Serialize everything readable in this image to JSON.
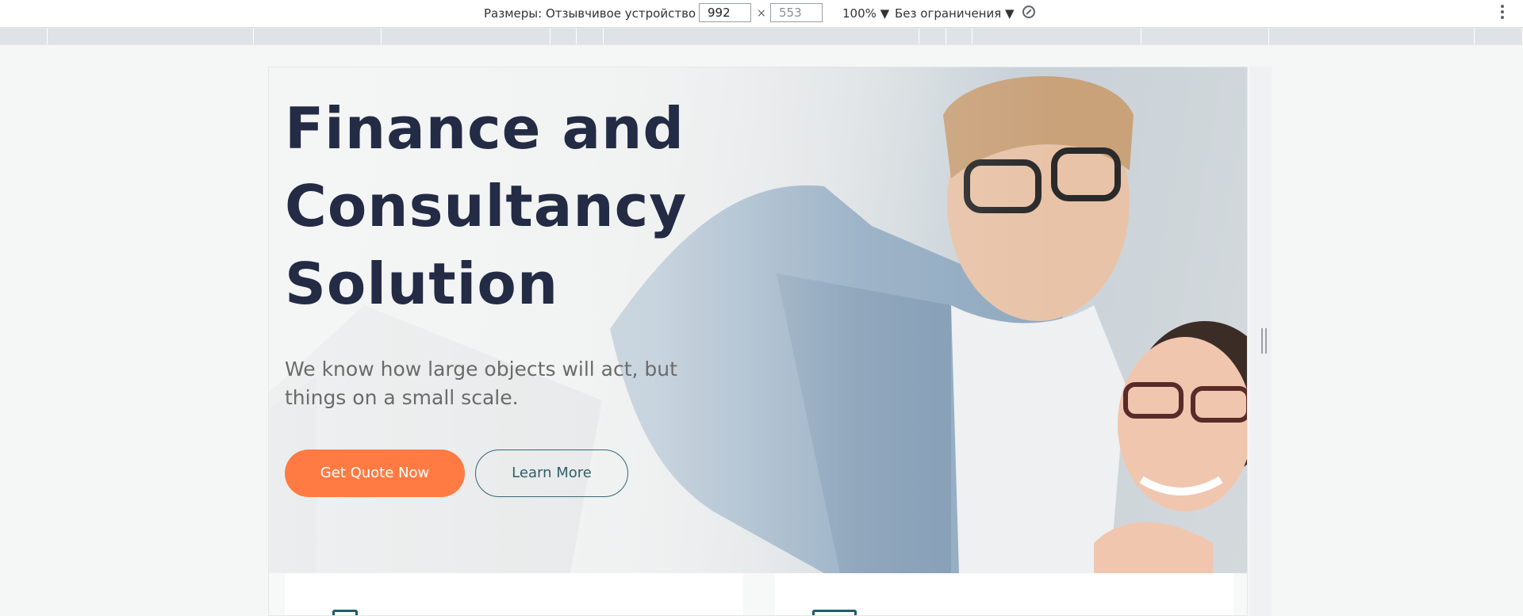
{
  "devtools": {
    "dimensions_label": "Размеры: Отзывчивое устройство ▼",
    "width_value": "992",
    "times": "×",
    "height_value": "553",
    "zoom": "100% ▼",
    "throttle": "Без ограничения ▼",
    "rotate_icon": "rotate-icon",
    "more_icon": "more-vertical-icon"
  },
  "hero": {
    "title": "Finance and Consultancy Solution",
    "subtitle": "We know how large objects will act, but things on a small scale.",
    "primary_button": "Get Quote Now",
    "secondary_button": "Learn More"
  },
  "colors": {
    "accent": "#ff7b43",
    "heading": "#232b45",
    "teal": "#2f6a72"
  }
}
